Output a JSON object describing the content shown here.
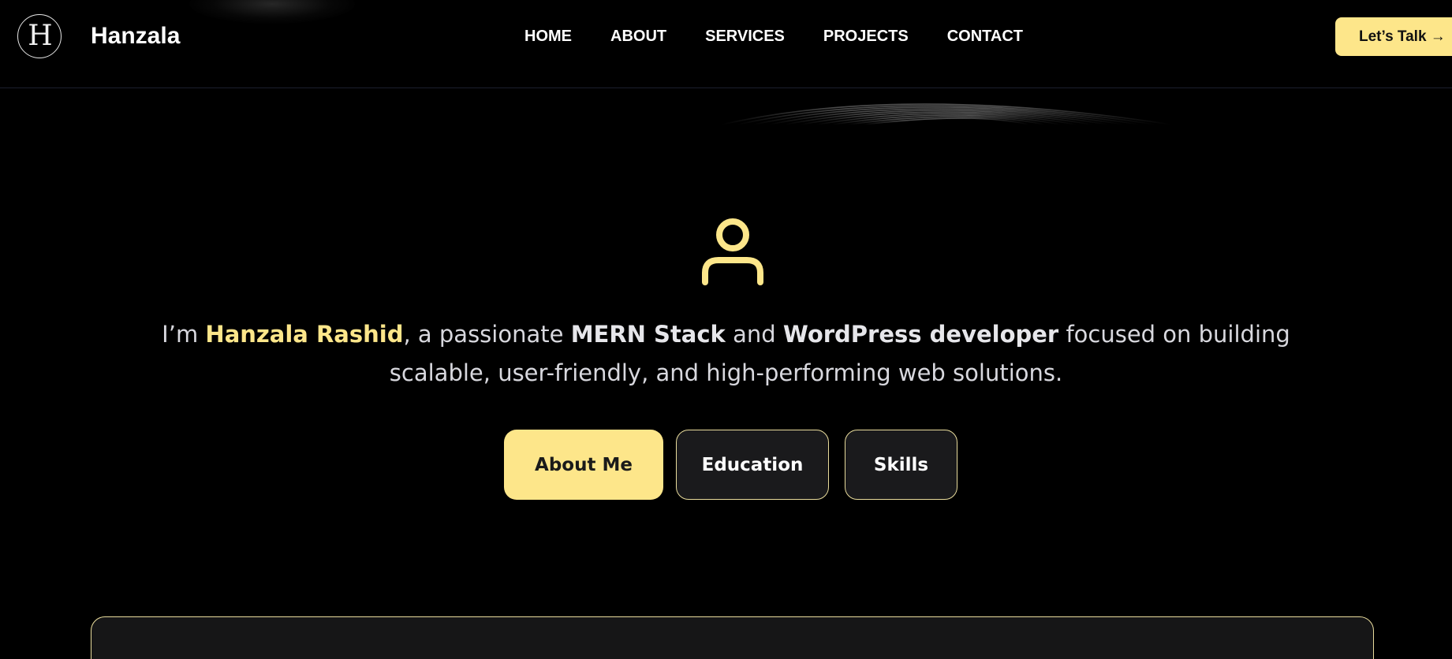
{
  "header": {
    "logo_letter": "H",
    "brand": "Hanzala",
    "nav": [
      "HOME",
      "ABOUT",
      "SERVICES",
      "PROJECTS",
      "CONTACT"
    ],
    "cta_label": "Let’s Talk →"
  },
  "hero": {
    "icon": "user-icon",
    "intro_prefix": "I’m ",
    "name": "Hanzala Rashid",
    "intro_mid1": ", a passionate ",
    "skill1": "MERN Stack",
    "intro_mid2": " and ",
    "skill2": "WordPress developer",
    "intro_suffix": " focused on building scalable, user-friendly, and high-performing web solutions."
  },
  "tabs": {
    "about": "About Me",
    "education": "Education",
    "skills": "Skills",
    "active": "About Me"
  },
  "colors": {
    "background": "#000000",
    "accent": "#fde68a",
    "tab_inactive_bg": "#1a1a1c",
    "tab_border": "#e9dc9c",
    "text": "#d8d8de"
  }
}
